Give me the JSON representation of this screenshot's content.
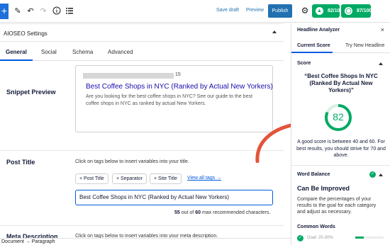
{
  "toolbar": {
    "add_label": "+",
    "save_draft": "Save draft",
    "preview": "Preview",
    "publish": "Publish",
    "truseo_score": "82/100",
    "headline_score": "87/100",
    "truseo_color": "#00aa63",
    "headline_color": "#00aa63"
  },
  "settings": {
    "title": "AIOSEO Settings",
    "tabs": [
      "General",
      "Social",
      "Schema",
      "Advanced"
    ]
  },
  "snippet": {
    "label": "Snippet Preview",
    "url_suffix": "15",
    "title": "Best Coffee Shops in NYC (Ranked by Actual New Yorkers)",
    "description": "Are you looking for the best coffee shops in NYC? See our guide to the best coffee shops in NYC as ranked by actual New Yorkers."
  },
  "post_title": {
    "label": "Post Title",
    "help": "Click on tags below to insert variables into your title.",
    "tags": [
      "+ Post Title",
      "+ Separator",
      "+ Site Title"
    ],
    "view_all": "View all tags →",
    "value": "Best Coffee Shops in NYC (Ranked by Actual New Yorkers)",
    "count": "55",
    "max": "60",
    "count_mid": " out of ",
    "count_suffix": " max recommended characters."
  },
  "meta_description": {
    "label": "Meta Description",
    "help": "Click on tags below to insert variables into your meta description."
  },
  "statusbar": {
    "breadcrumb": "Document → Paragraph"
  },
  "panel": {
    "title": "Headline Analyzer",
    "close": "×",
    "tabs": [
      "Current Score",
      "Try New Headline"
    ],
    "score_label": "Score",
    "headline": "“Best Coffee Shops In NYC (Ranked By Actual New Yorkers)”",
    "score": "82",
    "score_fraction": 0.82,
    "message": "A good score is between 40 and 60. For best results, you should strive for 70 and above.",
    "word_balance_label": "Word Balance",
    "word_balance_status": "Can Be Improved",
    "word_balance_text": "Compare the percentages of your results to the goal for each category and adjust as necessary.",
    "common_words_label": "Common Words",
    "common_words_goal": "Goal: 20-30%"
  }
}
